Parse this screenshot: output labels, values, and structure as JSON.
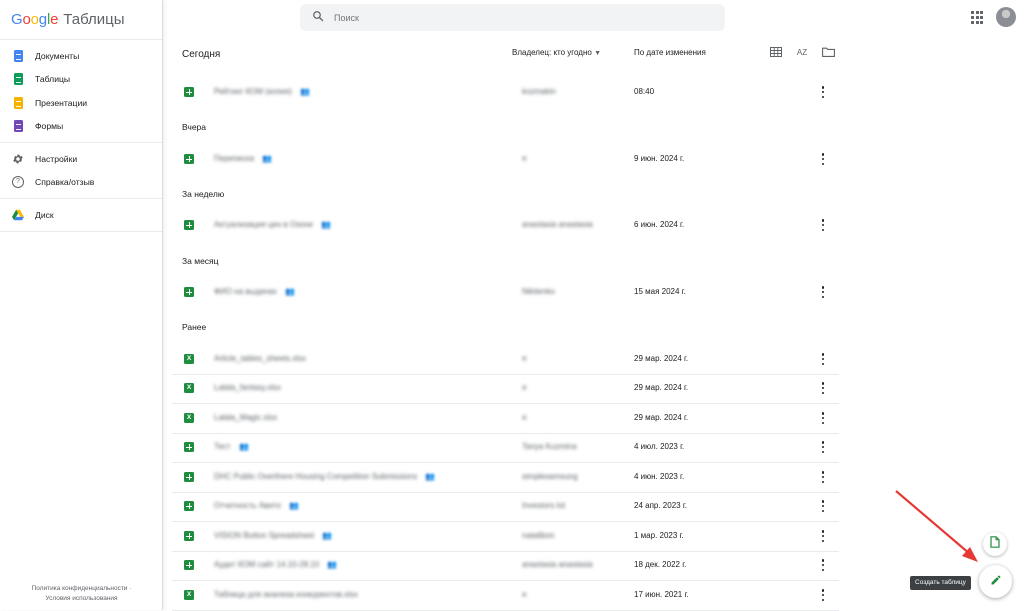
{
  "brand": {
    "google": "Google",
    "app": "Таблицы"
  },
  "search": {
    "placeholder": "Поиск"
  },
  "sidebar": {
    "apps": [
      {
        "label": "Документы",
        "color": "#4285f4"
      },
      {
        "label": "Таблицы",
        "color": "#0f9d58"
      },
      {
        "label": "Презентации",
        "color": "#f4b400"
      },
      {
        "label": "Формы",
        "color": "#7248b9"
      }
    ],
    "settings": "Настройки",
    "help": "Справка/отзыв",
    "drive": "Диск",
    "footer": {
      "privacy": "Политика конфиденциальности",
      "sep": "·",
      "terms": "Условия использования"
    }
  },
  "list": {
    "title": "Сегодня",
    "owner_filter": "Владелец: кто угодно",
    "sort": "По дате изменения",
    "sort_icon_label": "AZ"
  },
  "sections": {
    "yesterday": "Вчера",
    "week": "За неделю",
    "month": "За месяц",
    "earlier": "Ранее"
  },
  "files": [
    {
      "name": "Рейтинг КОМ (копия)",
      "owner": "kozmakin",
      "date": "08:40",
      "type": "sheet",
      "shared": true
    },
    {
      "name": "Переписка",
      "owner": "я",
      "date": "9 июн. 2024 г.",
      "type": "sheet",
      "shared": true
    },
    {
      "name": "Актуализация цен в Озоне",
      "owner": "anastasia anastasia",
      "date": "6 июн. 2024 г.",
      "type": "sheet",
      "shared": true
    },
    {
      "name": "ФИО на выдачах",
      "owner": "Nikitenko",
      "date": "15 мая 2024 г.",
      "type": "sheet",
      "shared": true
    },
    {
      "name": "Article_tables_sheets.xlsx",
      "owner": "я",
      "date": "29 мар. 2024 г.",
      "type": "xlsx",
      "shared": false
    },
    {
      "name": "Lalala_fantasy.xlsx",
      "owner": "я",
      "date": "29 мар. 2024 г.",
      "type": "xlsx",
      "shared": false
    },
    {
      "name": "Lalala_Magic.xlsx",
      "owner": "я",
      "date": "29 мар. 2024 г.",
      "type": "xlsx",
      "shared": false
    },
    {
      "name": "Тест",
      "owner": "Tanya Kuzmina",
      "date": "4 июл. 2023 г.",
      "type": "sheet",
      "shared": true
    },
    {
      "name": "DHC Public Overthere Housing Competition Submissions",
      "owner": "simplesamsung",
      "date": "4 июн. 2023 г.",
      "type": "sheet",
      "shared": true
    },
    {
      "name": "Отчетность Авито",
      "owner": "Investors lot",
      "date": "24 апр. 2023 г.",
      "type": "sheet",
      "shared": true
    },
    {
      "name": "VISION Button Spreadsheet",
      "owner": "natalibon",
      "date": "1 мар. 2023 г.",
      "type": "sheet",
      "shared": true
    },
    {
      "name": "Аудит КОМ сайт 14.10-28.10",
      "owner": "anastasia anastasia",
      "date": "18 дек. 2022 г.",
      "type": "sheet",
      "shared": true
    },
    {
      "name": "Таблица для анализа конкурентов.xlsx",
      "owner": "я",
      "date": "17 июн. 2021 г.",
      "type": "xlsx",
      "shared": false
    }
  ],
  "fab": {
    "tooltip": "Создать таблицу"
  },
  "colors": {
    "accent_green": "#1e8e3e",
    "arrow": "#e53935"
  }
}
